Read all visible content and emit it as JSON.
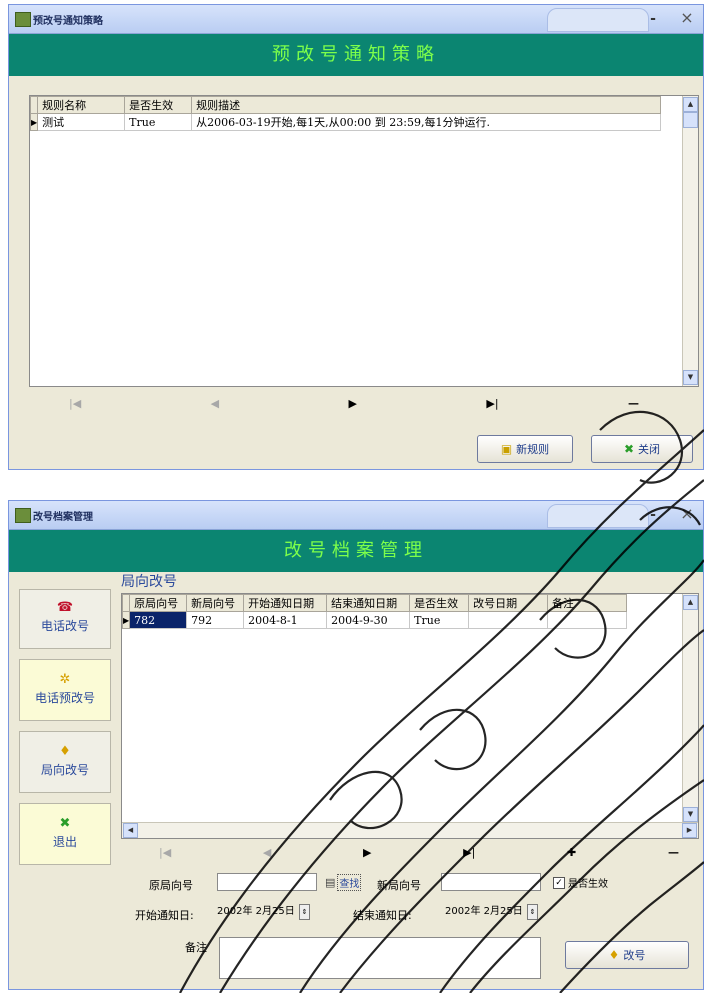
{
  "window1": {
    "title": "预改号通知策略",
    "banner": "预改号通知策略",
    "minimize": "-",
    "close": "×",
    "columns": [
      "规则名称",
      "是否生效",
      "规则描述"
    ],
    "rows": [
      [
        "测试",
        "True",
        "从2006-03-19开始,每1天,从00:00 到 23:59,每1分钟运行."
      ]
    ],
    "nav": {
      "first": "|◀",
      "prev": "◀",
      "next": "▶",
      "last": "▶|",
      "delete": "—"
    },
    "buttons": {
      "new_rule": "新规则",
      "close": "关闭"
    }
  },
  "window2": {
    "title": "改号档案管理",
    "banner": "改号档案管理",
    "minimize": "-",
    "close": "×",
    "section_title": "局向改号",
    "sidebar": [
      {
        "label": "电话改号",
        "icon": "phone-icon",
        "symbol": "☎"
      },
      {
        "label": "电话预改号",
        "icon": "sparkle-icon",
        "symbol": "✲"
      },
      {
        "label": "局向改号",
        "icon": "bulb-icon",
        "symbol": "♦"
      },
      {
        "label": "退出",
        "icon": "exit-icon",
        "symbol": "✖"
      }
    ],
    "columns": [
      "原局向号",
      "新局向号",
      "开始通知日期",
      "结束通知日期",
      "是否生效",
      "改号日期",
      "备注"
    ],
    "rows": [
      [
        "782",
        "792",
        "2004-8-1",
        "2004-9-30",
        "True",
        "",
        ""
      ]
    ],
    "nav": {
      "first": "|◀",
      "prev": "◀",
      "next": "▶",
      "last": "▶|",
      "add": "✚",
      "delete": "—"
    },
    "form": {
      "old_prefix_label": "原局向号",
      "old_prefix_value": "",
      "query_button": "查找",
      "new_prefix_label": "新局向号",
      "new_prefix_value": "",
      "active_label": "是否生效",
      "start_date_label": "开始通知日:",
      "start_date_value": "2002年 2月25日",
      "end_date_label": "结束通知日:",
      "end_date_value": "2002年 2月25日",
      "remark_label": "备注",
      "remark_value": "",
      "submit_button": "改号"
    }
  },
  "colors": {
    "banner_bg": "#0b8571",
    "banner_text": "#7dff4a",
    "window_bg": "#ece9d8",
    "titlebar": "#c8d7f5"
  }
}
